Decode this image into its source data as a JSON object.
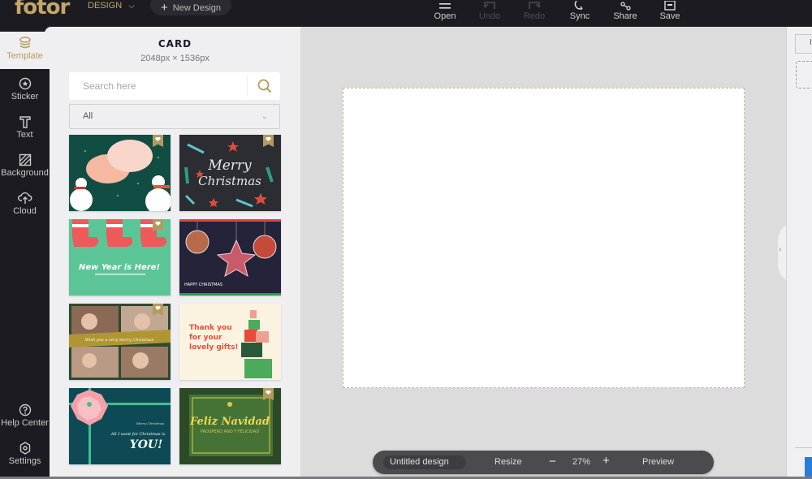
{
  "app": {
    "logo": "fotor",
    "logo_mark": "®",
    "design_menu": "DESIGN",
    "new_design": "New Design"
  },
  "toolbar": {
    "items": [
      {
        "label": "Open",
        "icon": "menu-icon",
        "enabled": true
      },
      {
        "label": "Undo",
        "icon": "undo-icon",
        "enabled": false
      },
      {
        "label": "Redo",
        "icon": "redo-icon",
        "enabled": false
      },
      {
        "label": "Sync",
        "icon": "sync-icon",
        "enabled": true
      },
      {
        "label": "Share",
        "icon": "share-icon",
        "enabled": true
      },
      {
        "label": "Save",
        "icon": "save-icon",
        "enabled": true
      }
    ]
  },
  "sidebar": {
    "items": [
      {
        "label": "Template",
        "icon": "layers-icon",
        "active": true
      },
      {
        "label": "Sticker",
        "icon": "sticker-icon",
        "active": false
      },
      {
        "label": "Text",
        "icon": "text-icon",
        "active": false
      },
      {
        "label": "Background",
        "icon": "background-icon",
        "active": false
      },
      {
        "label": "Cloud",
        "icon": "cloud-upload-icon",
        "active": false
      }
    ],
    "bottom_items": [
      {
        "label": "Help Center",
        "icon": "help-icon"
      },
      {
        "label": "Settings",
        "icon": "settings-icon"
      }
    ]
  },
  "panel": {
    "title": "CARD",
    "dimensions": "2048px × 1536px",
    "search_placeholder": "Search here",
    "search_value": "",
    "filter_selected": "All",
    "templates": [
      {
        "name": "Snowmen speech bubbles",
        "premium": true,
        "text": ""
      },
      {
        "name": "Merry Christmas dark",
        "premium": true,
        "text": "Merry Christmas"
      },
      {
        "name": "Stockings new year",
        "premium": true,
        "text": "New Year is Here!"
      },
      {
        "name": "Ornament photos",
        "premium": false,
        "text": "HAPPY CHRISTMAS"
      },
      {
        "name": "Photo collage christmas",
        "premium": true,
        "text": "Wish you a very merry Christmas"
      },
      {
        "name": "Thank you gifts",
        "premium": false,
        "text": "Thank you for your lovely gifts!"
      },
      {
        "name": "Bow all I want",
        "premium": false,
        "text": "All I want for Christmas is YOU!"
      },
      {
        "name": "Feliz Navidad",
        "premium": true,
        "text": "Feliz Navidad"
      }
    ]
  },
  "bottombar": {
    "design_name": "Untitled design",
    "resize": "Resize",
    "zoom_out": "−",
    "zoom_level": "27%",
    "zoom_in": "+",
    "preview": "Preview"
  },
  "colors": {
    "accent": "#c4a668",
    "topbar": "#1c1b21",
    "panel": "#efeff2"
  }
}
